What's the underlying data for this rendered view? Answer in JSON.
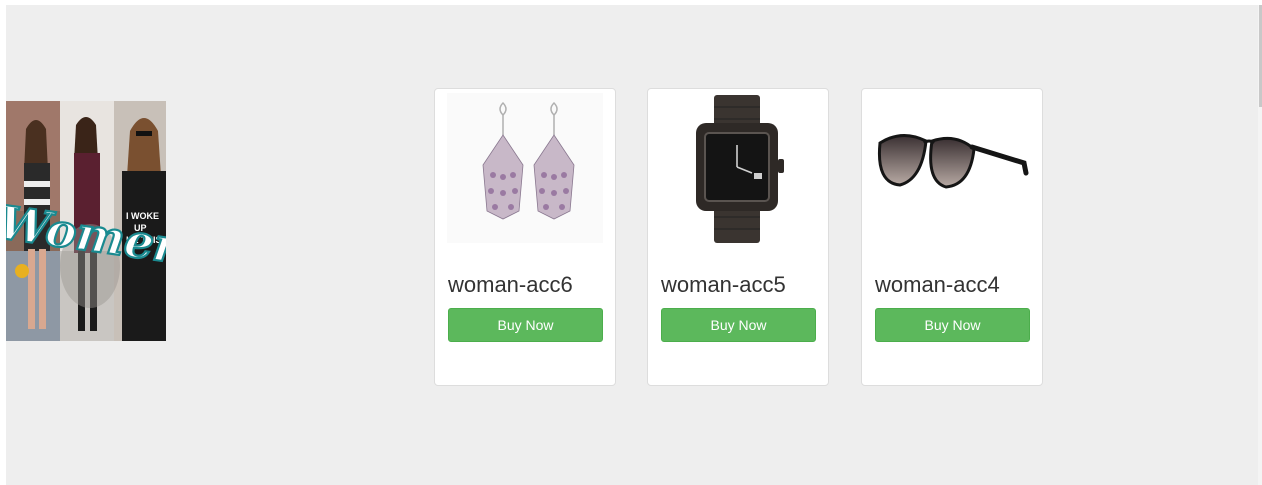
{
  "banner": {
    "text": "Women",
    "shirt_text": "I WOKE UP LIKE THIS"
  },
  "products": [
    {
      "title": "woman-acc6",
      "button": "Buy Now",
      "image": "earrings-image"
    },
    {
      "title": "woman-acc5",
      "button": "Buy Now",
      "image": "watch-image"
    },
    {
      "title": "woman-acc4",
      "button": "Buy Now",
      "image": "sunglasses-image"
    }
  ],
  "colors": {
    "background": "#eeeeee",
    "button": "#5cb85c",
    "card": "#ffffff"
  }
}
